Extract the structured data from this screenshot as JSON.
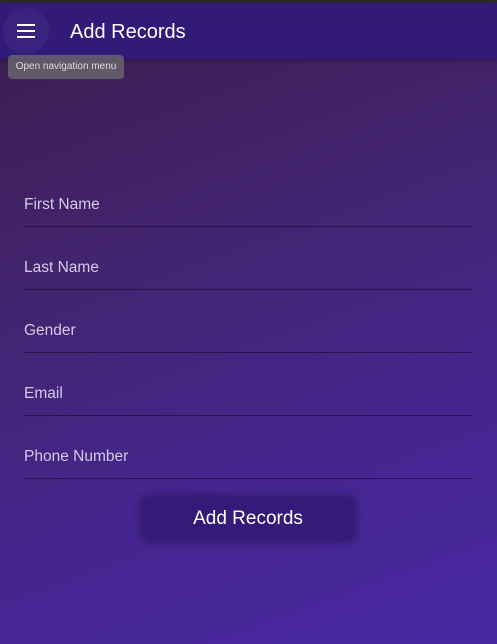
{
  "app_bar": {
    "title": "Add Records",
    "menu_icon": "hamburger-menu-icon",
    "menu_tooltip": "Open navigation menu"
  },
  "form": {
    "fields": [
      {
        "label": "First Name",
        "value": ""
      },
      {
        "label": "Last Name",
        "value": ""
      },
      {
        "label": "Gender",
        "value": ""
      },
      {
        "label": "Email",
        "value": ""
      },
      {
        "label": "Phone Number",
        "value": ""
      }
    ],
    "submit_label": "Add Records"
  },
  "colors": {
    "app_bar": "#321b78",
    "button": "#341b79",
    "background_top": "#3a1d4c",
    "background_bottom": "#4828a0"
  }
}
